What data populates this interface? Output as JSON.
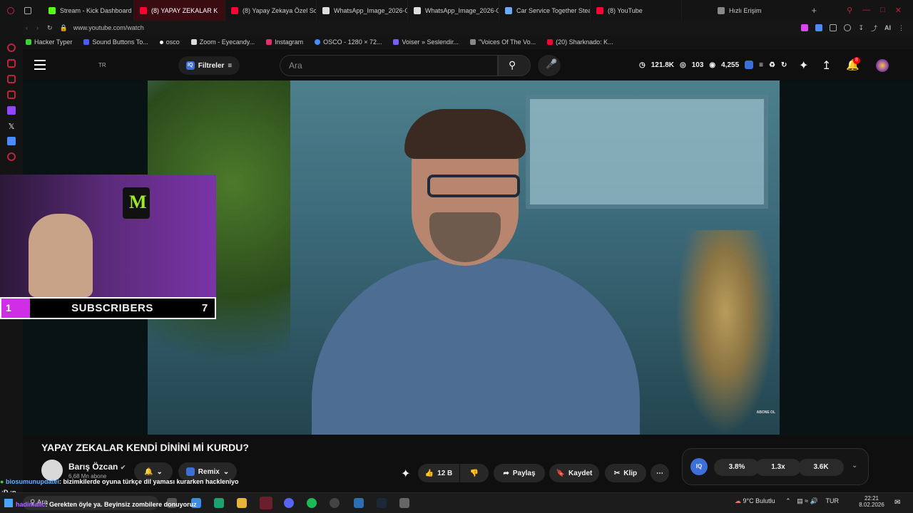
{
  "browser": {
    "tabs": [
      {
        "label": "Stream - Kick Dashboard",
        "color": "#53fc18"
      },
      {
        "label": "(8) YAPAY ZEKALAR K",
        "color": "#ff0033",
        "active": true
      },
      {
        "label": "(8) Yapay Zekaya Özel So",
        "color": "#ff0033"
      },
      {
        "label": "WhatsApp_Image_2026-0",
        "color": "#dddddd"
      },
      {
        "label": "WhatsApp_Image_2026-0",
        "color": "#dddddd"
      },
      {
        "label": "Car Service Together Stea",
        "color": "#6aa9ff"
      },
      {
        "label": "(8) YouTube",
        "color": "#ff0033"
      }
    ],
    "quick_access": "Hızlı Erişim",
    "url": "www.youtube.com/watch",
    "ai_label": "AI",
    "bookmarks": [
      {
        "label": "Hacker Typer",
        "color": "#3ad13a"
      },
      {
        "label": "Sound Buttons To...",
        "color": "#4a5cff"
      },
      {
        "label": "osco",
        "color": "#ffffff"
      },
      {
        "label": "Zoom - Eyecandy...",
        "color": "#dddddd"
      },
      {
        "label": "Instagram",
        "color": "#e1306c"
      },
      {
        "label": "OSCO - 1280 × 72...",
        "color": "#4a8cff"
      },
      {
        "label": "Voiser » Seslendir...",
        "color": "#7a5cff"
      },
      {
        "label": "\"Voices Of The Vo...",
        "color": "#888888"
      },
      {
        "label": "(20) Sharknado: K...",
        "color": "#ff0033"
      }
    ]
  },
  "youtube": {
    "country": "TR",
    "filter_label": "Filtreler",
    "search_placeholder": "Ara",
    "header_stats": {
      "views": "121.8K",
      "comments": "103",
      "watching": "4,255"
    },
    "notifications": "8",
    "video": {
      "title": "YAPAY ZEKALAR KENDİ DİNİNİ Mİ KURDU?",
      "channel": "Barış Özcan",
      "subscribers": "6,68 Mn abone",
      "corner_text": "ABONE OL",
      "likes": "12 B",
      "actions": {
        "remix": "Remix",
        "share": "Paylaş",
        "save": "Kaydet",
        "clip": "Klip"
      },
      "stats": [
        "3.8%",
        "1.3x",
        "3.6K"
      ]
    }
  },
  "overlay": {
    "sub_left": "1",
    "sub_label": "SUBSCRIBERS",
    "sub_right": "7",
    "chat1_user": "biosumunupdatei",
    "chat1_text": ": bizimkilerde oyuna türkçe dil yaması kurarken hackleniyo",
    "chat2_user": "hadimalic",
    "chat2_text": ": Gerekten öyle ya. Beyinsiz zombilere donuyoruz",
    "side_text": ":D :p"
  },
  "taskbar": {
    "search": "Ara",
    "weather": "9°C  Bulutlu",
    "lang": "TUR",
    "time": "22:21",
    "date": "8.02.2026"
  }
}
